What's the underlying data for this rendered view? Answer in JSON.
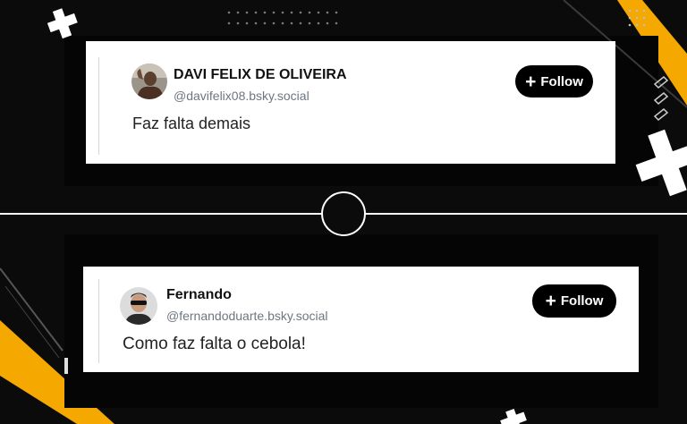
{
  "posts": [
    {
      "author_name": "DAVI FELIX DE OLIVEIRA",
      "handle": "@davifelix08.bsky.social",
      "text": "Faz falta demais",
      "follow_icon": "+",
      "follow_label": "Follow"
    },
    {
      "author_name": "Fernando",
      "handle": "@fernandoduarte.bsky.social",
      "text": "Como faz falta o cebola!",
      "follow_icon": "+",
      "follow_label": "Follow"
    }
  ],
  "colors": {
    "background": "#0b0b0b",
    "accent": "#f5a800",
    "card": "#ffffff",
    "button": "#000000",
    "handle_text": "#6e7681"
  }
}
